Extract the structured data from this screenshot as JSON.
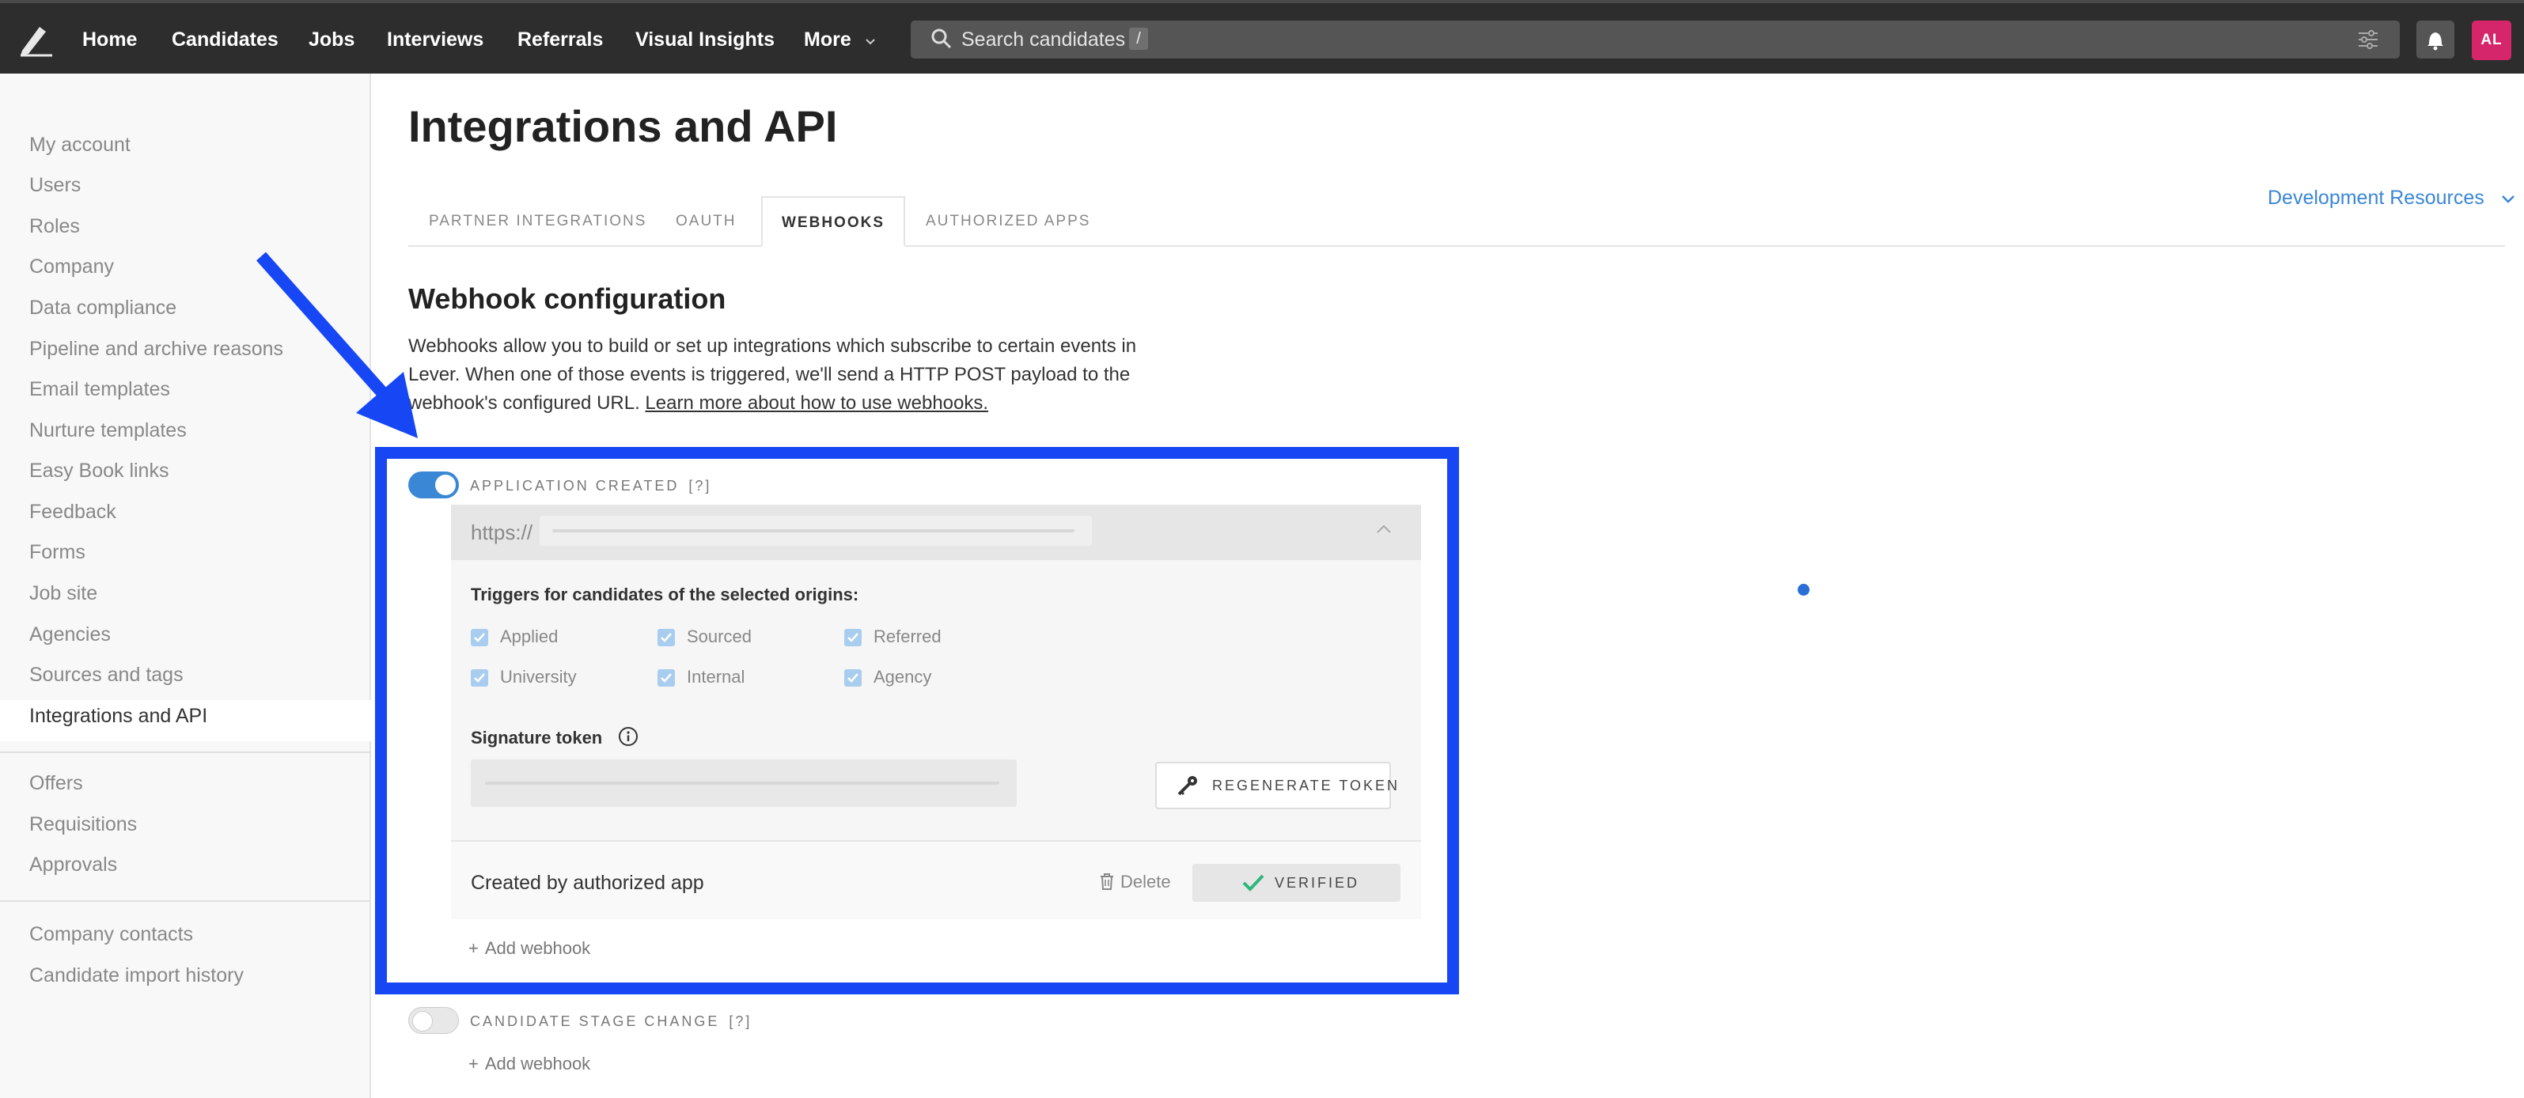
{
  "nav": {
    "items": [
      "Home",
      "Candidates",
      "Jobs",
      "Interviews",
      "Referrals",
      "Visual Insights",
      "More"
    ],
    "search_placeholder": "Search candidates",
    "search_shortcut": "/",
    "avatar_initials": "AL"
  },
  "sidebar": {
    "group1": [
      "My account",
      "Users",
      "Roles",
      "Company",
      "Data compliance",
      "Pipeline and archive reasons",
      "Email templates",
      "Nurture templates",
      "Easy Book links",
      "Feedback",
      "Forms",
      "Job site",
      "Agencies",
      "Sources and tags",
      "Integrations and API"
    ],
    "group2": [
      "Offers",
      "Requisitions",
      "Approvals"
    ],
    "group3": [
      "Company contacts",
      "Candidate import history"
    ],
    "active": "Integrations and API"
  },
  "page": {
    "title": "Integrations and API",
    "tabs": [
      "PARTNER INTEGRATIONS",
      "OAUTH",
      "WEBHOOKS",
      "AUTHORIZED APPS"
    ],
    "active_tab": "WEBHOOKS",
    "dev_resources": "Development Resources"
  },
  "webhooks": {
    "title": "Webhook configuration",
    "desc_text": "Webhooks allow you to build or set up integrations which subscribe to certain events in Lever. When one of those events is triggered, we'll send a HTTP POST payload to the webhook's configured URL.",
    "desc_link": "Learn more about how to use webhooks.",
    "events": [
      {
        "label": "APPLICATION CREATED",
        "help": "[?]",
        "enabled": true,
        "url_prefix": "https://",
        "triggers_title": "Triggers for candidates of the selected origins:",
        "triggers": [
          "Applied",
          "Sourced",
          "Referred",
          "University",
          "Internal",
          "Agency"
        ],
        "signature_title": "Signature token",
        "regenerate_label": "REGENERATE TOKEN",
        "created_by": "Created by authorized app",
        "delete_label": "Delete",
        "verified_label": "VERIFIED",
        "add_label": "Add webhook"
      },
      {
        "label": "CANDIDATE STAGE CHANGE",
        "help": "[?]",
        "enabled": false,
        "add_label": "Add webhook"
      }
    ]
  },
  "colors": {
    "accent": "#3a87d6",
    "highlight": "#1747f5",
    "nav_bg": "#2d2d2d",
    "avatar": "#d6266b",
    "verified_check": "#2eb67d"
  }
}
